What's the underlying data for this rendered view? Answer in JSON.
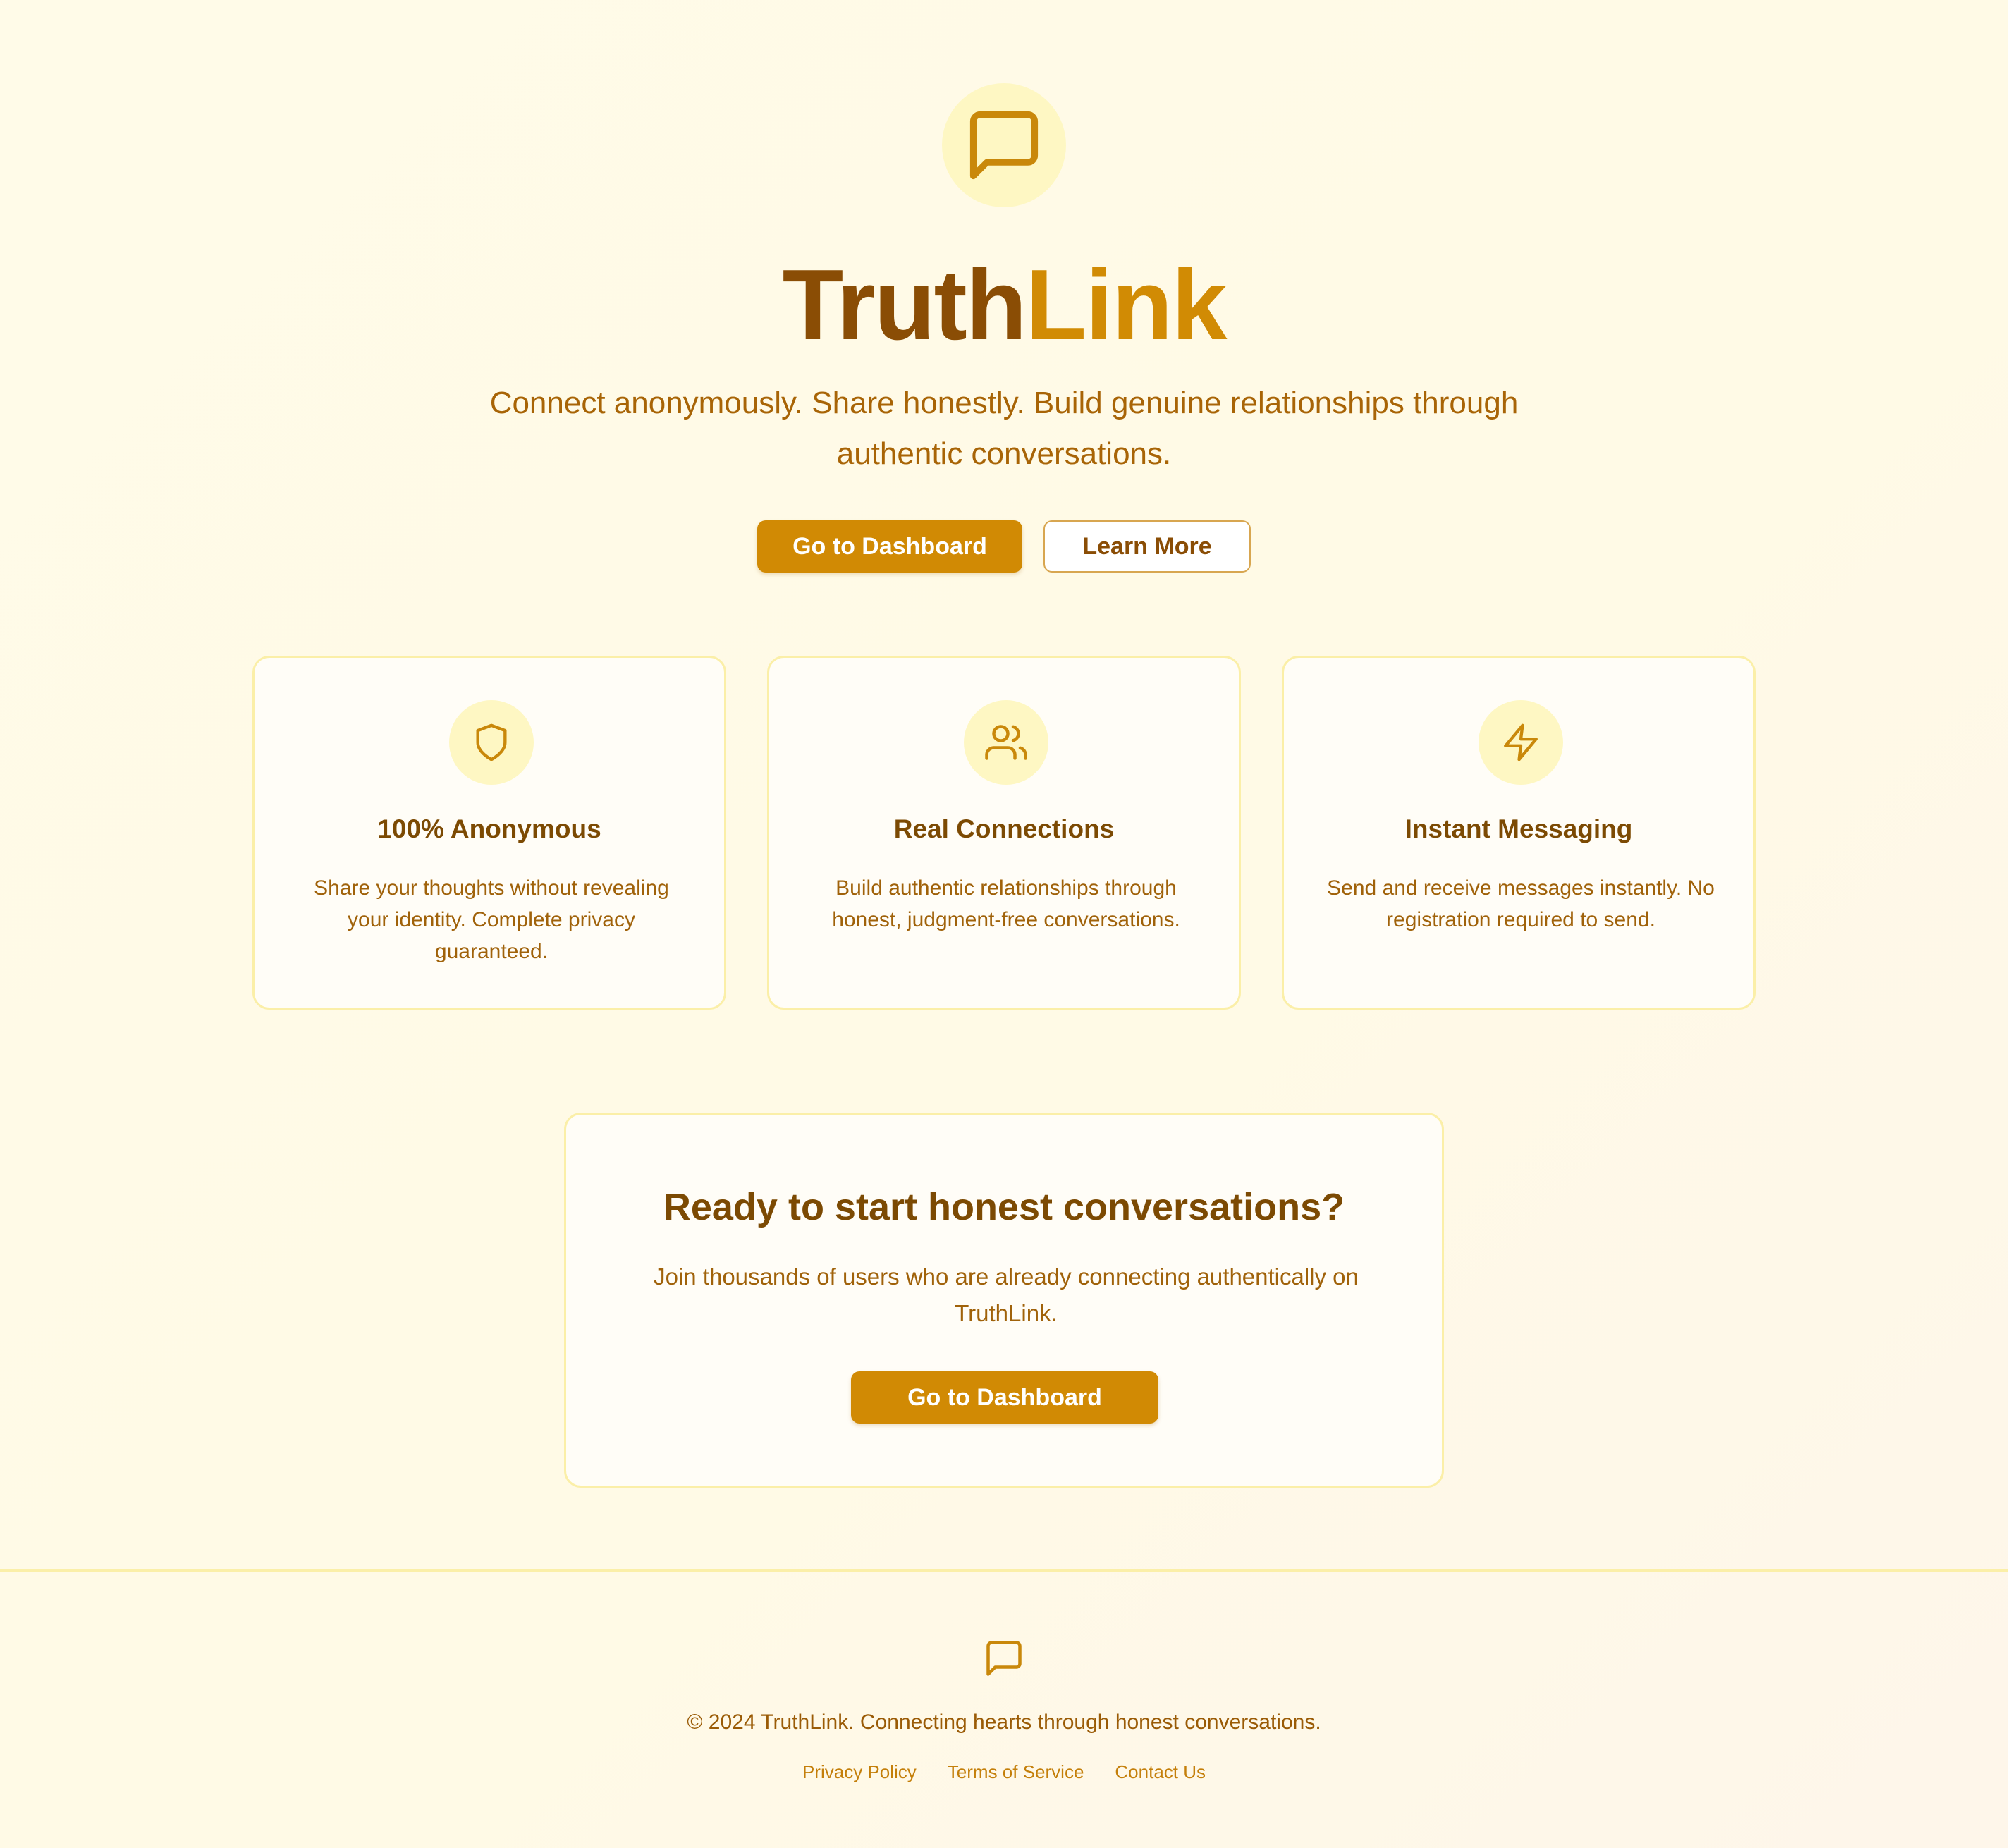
{
  "brand": {
    "name_part1": "Truth",
    "name_part2": "Link",
    "logo_icon": "message-square-icon"
  },
  "hero": {
    "tagline": "Connect anonymously. Share honestly. Build genuine relationships through authentic conversations.",
    "primary_button": "Go to Dashboard",
    "secondary_button": "Learn More"
  },
  "features": [
    {
      "icon": "shield-icon",
      "title": "100% Anonymous",
      "description": "Share your thoughts without revealing your identity. Complete privacy guaranteed."
    },
    {
      "icon": "users-icon",
      "title": "Real Connections",
      "description": "Build authentic relationships through honest, judgment-free conversations."
    },
    {
      "icon": "lightning-icon",
      "title": "Instant Messaging",
      "description": "Send and receive messages instantly. No registration required to send."
    }
  ],
  "cta": {
    "title": "Ready to start honest conversations?",
    "description": "Join thousands of users who are already connecting authentically on TruthLink.",
    "button": "Go to Dashboard"
  },
  "footer": {
    "icon": "message-square-icon",
    "copyright": "© 2024 TruthLink. Connecting hearts through honest conversations.",
    "links": [
      "Privacy Policy",
      "Terms of Service",
      "Contact Us"
    ]
  },
  "colors": {
    "accent": "#d18a04",
    "brand_dark": "#8a4d05",
    "icon_bg": "#fef7c3",
    "card_border": "#fbefa8",
    "background": "#fffbe8"
  }
}
